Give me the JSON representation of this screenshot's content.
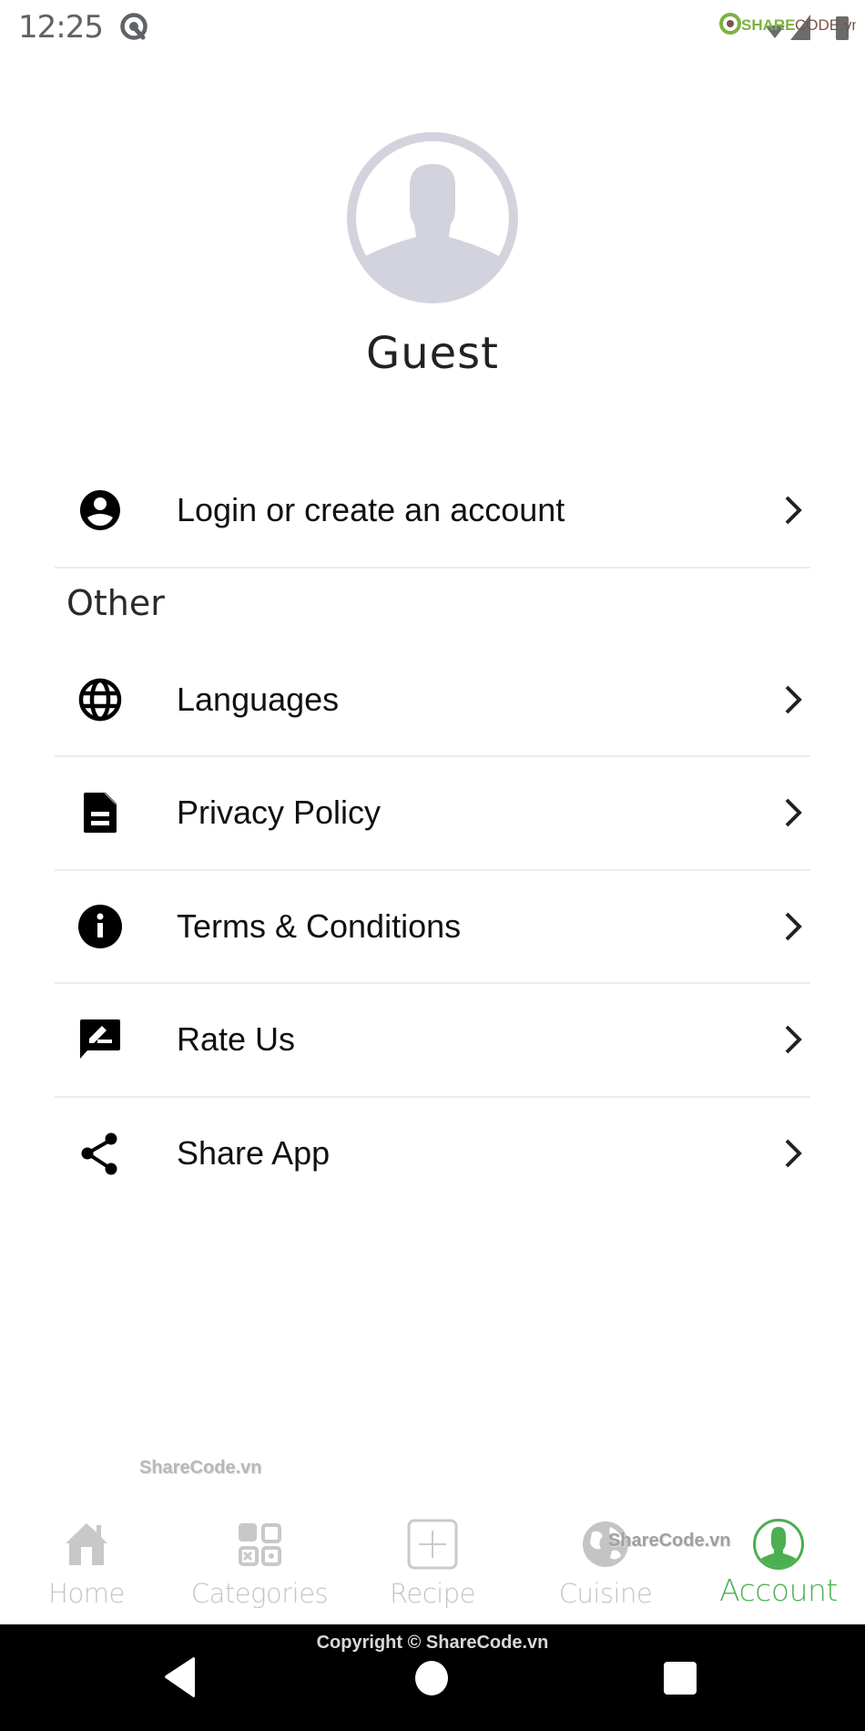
{
  "status_bar": {
    "time": "12:25",
    "left_icons": [
      "android-q-icon"
    ],
    "right_icons": [
      "sharecode-logo",
      "wifi-icon",
      "signal-icon",
      "battery-icon"
    ],
    "logo_text": "SHARECODE.vn"
  },
  "profile": {
    "avatar_icon": "default-avatar-icon",
    "name": "Guest"
  },
  "account_row": {
    "icon": "account-circle-icon",
    "label": "Login or create an account"
  },
  "other_section": {
    "title": "Other",
    "items": [
      {
        "icon": "globe-icon",
        "label": "Languages"
      },
      {
        "icon": "document-icon",
        "label": "Privacy Policy"
      },
      {
        "icon": "info-icon",
        "label": "Terms & Conditions"
      },
      {
        "icon": "rate-review-icon",
        "label": "Rate Us"
      },
      {
        "icon": "share-icon",
        "label": "Share App"
      }
    ]
  },
  "watermarks": [
    "ShareCode.vn",
    "ShareCode.vn"
  ],
  "bottom_nav": {
    "active": "Account",
    "active_color": "#4caf50",
    "inactive_color": "#c4c4c4",
    "items": [
      {
        "icon": "home-icon",
        "label": "Home"
      },
      {
        "icon": "categories-icon",
        "label": "Categories"
      },
      {
        "icon": "add-recipe-icon",
        "label": "Recipe"
      },
      {
        "icon": "globe-cuisine-icon",
        "label": "Cuisine"
      },
      {
        "icon": "account-icon",
        "label": "Account"
      }
    ]
  },
  "system_bar": {
    "copyright": "Copyright © ShareCode.vn",
    "buttons": [
      "back",
      "home",
      "recents"
    ]
  }
}
